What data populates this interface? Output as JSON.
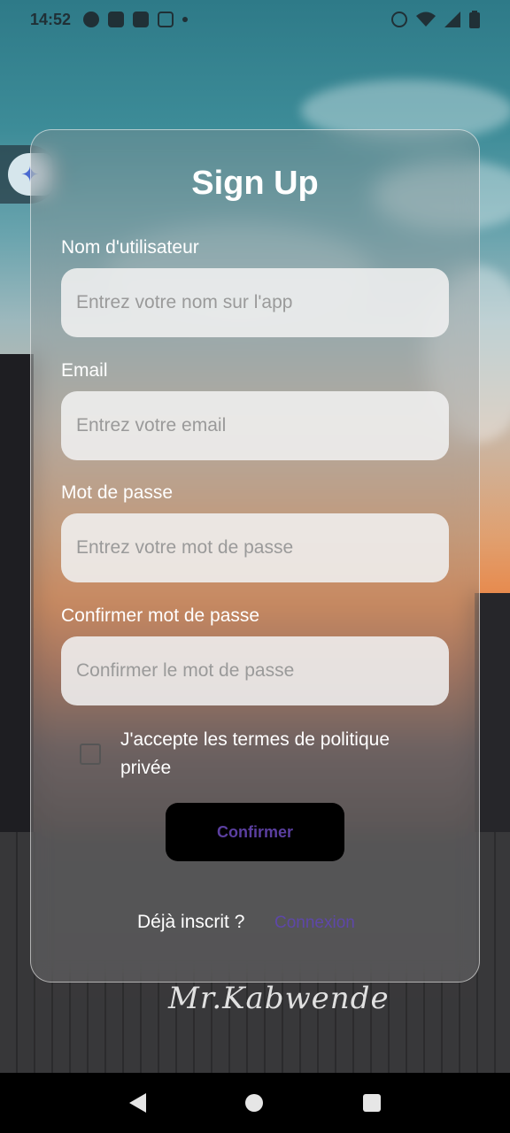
{
  "status_bar": {
    "time": "14:52",
    "left_icons": [
      "whatsapp-icon",
      "facebook-icon",
      "facebook-icon",
      "instagram-icon",
      "dot-icon"
    ],
    "right_icons": [
      "mute-icon",
      "wifi-icon",
      "signal-icon",
      "battery-icon"
    ]
  },
  "signup": {
    "title": "Sign Up",
    "fields": [
      {
        "label": "Nom d'utilisateur",
        "placeholder": "Entrez votre nom sur l'app",
        "value": ""
      },
      {
        "label": "Email",
        "placeholder": "Entrez votre email",
        "value": ""
      },
      {
        "label": "Mot de passe",
        "placeholder": "Entrez votre mot de passe",
        "value": ""
      },
      {
        "label": "Confirmer mot de passe",
        "placeholder": "Confirmer le mot de passe",
        "value": ""
      }
    ],
    "terms_label": "J'accepte les termes de politique privée",
    "terms_checked": false,
    "confirm_label": "Confirmer",
    "already_registered": "Déjà inscrit ?",
    "login_link": "Connexion"
  },
  "background": {
    "signature": "Mr.Kabwende"
  },
  "colors": {
    "accent": "#5e47a8",
    "button_bg": "#000000",
    "input_bg": "#f0f0f0"
  }
}
